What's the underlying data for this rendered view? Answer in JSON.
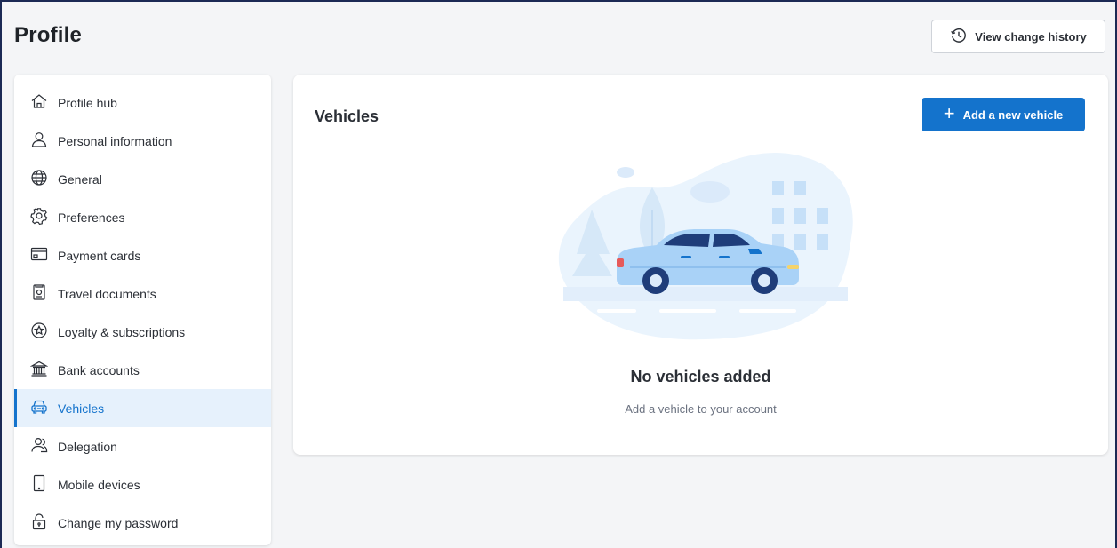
{
  "header": {
    "title": "Profile",
    "history_button": {
      "label": "View change history",
      "icon": "history-icon"
    }
  },
  "sidebar": {
    "items": [
      {
        "label": "Profile hub",
        "icon": "home-icon",
        "active": false
      },
      {
        "label": "Personal information",
        "icon": "user-icon",
        "active": false
      },
      {
        "label": "General",
        "icon": "globe-icon",
        "active": false
      },
      {
        "label": "Preferences",
        "icon": "settings-icon",
        "active": false
      },
      {
        "label": "Payment cards",
        "icon": "credit-card-icon",
        "active": false
      },
      {
        "label": "Travel documents",
        "icon": "passport-icon",
        "active": false
      },
      {
        "label": "Loyalty & subscriptions",
        "icon": "star-badge-icon",
        "active": false
      },
      {
        "label": "Bank accounts",
        "icon": "bank-icon",
        "active": false
      },
      {
        "label": "Vehicles",
        "icon": "car-icon",
        "active": true
      },
      {
        "label": "Delegation",
        "icon": "users-icon",
        "active": false
      },
      {
        "label": "Mobile devices",
        "icon": "phone-icon",
        "active": false
      },
      {
        "label": "Change my password",
        "icon": "lock-icon",
        "active": false
      }
    ]
  },
  "main": {
    "title": "Vehicles",
    "add_button": {
      "label": "Add a new vehicle",
      "icon": "plus-icon"
    },
    "empty_state": {
      "title": "No vehicles added",
      "subtitle": "Add a vehicle to your account",
      "illustration": "car-illustration"
    }
  },
  "colors": {
    "accent": "#1473cc",
    "active_bg": "#e6f1fc",
    "page_bg": "#f4f5f7",
    "card_bg": "#ffffff",
    "text": "#2b2f36",
    "muted": "#6b7280"
  }
}
